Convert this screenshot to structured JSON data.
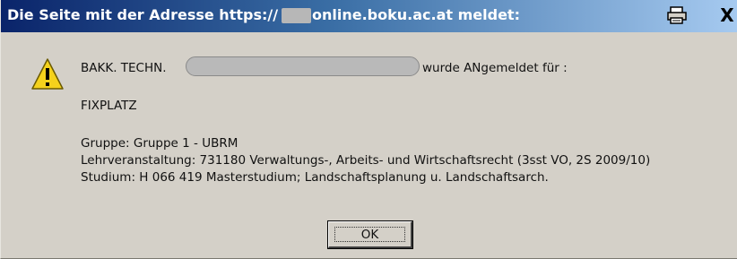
{
  "dialog": {
    "title_prefix": "Die Seite mit der Adresse https://",
    "title_suffix": "online.boku.ac.at meldet:",
    "close_label": "X",
    "message": {
      "line1_prefix": "BAKK. TECHN.",
      "line1_suffix": "wurde ANgemeldet für :",
      "line2": "FIXPLATZ",
      "details": [
        "Gruppe: Gruppe  1 - UBRM",
        "Lehrveranstaltung: 731180 Verwaltungs-, Arbeits- und Wirtschaftsrecht (3sst VO, 2S 2009/10)",
        "Studium: H 066 419 Masterstudium; Landschaftsplanung u. Landschaftsarch."
      ]
    },
    "ok_label": "OK"
  },
  "icons": {
    "warning": "warning-icon",
    "print": "print-icon",
    "close": "close-icon"
  },
  "colors": {
    "titlebar_start": "#0a246a",
    "titlebar_end": "#a6caf0",
    "dialog_bg": "#d4d0c8",
    "warning_yellow": "#f5d21c"
  }
}
